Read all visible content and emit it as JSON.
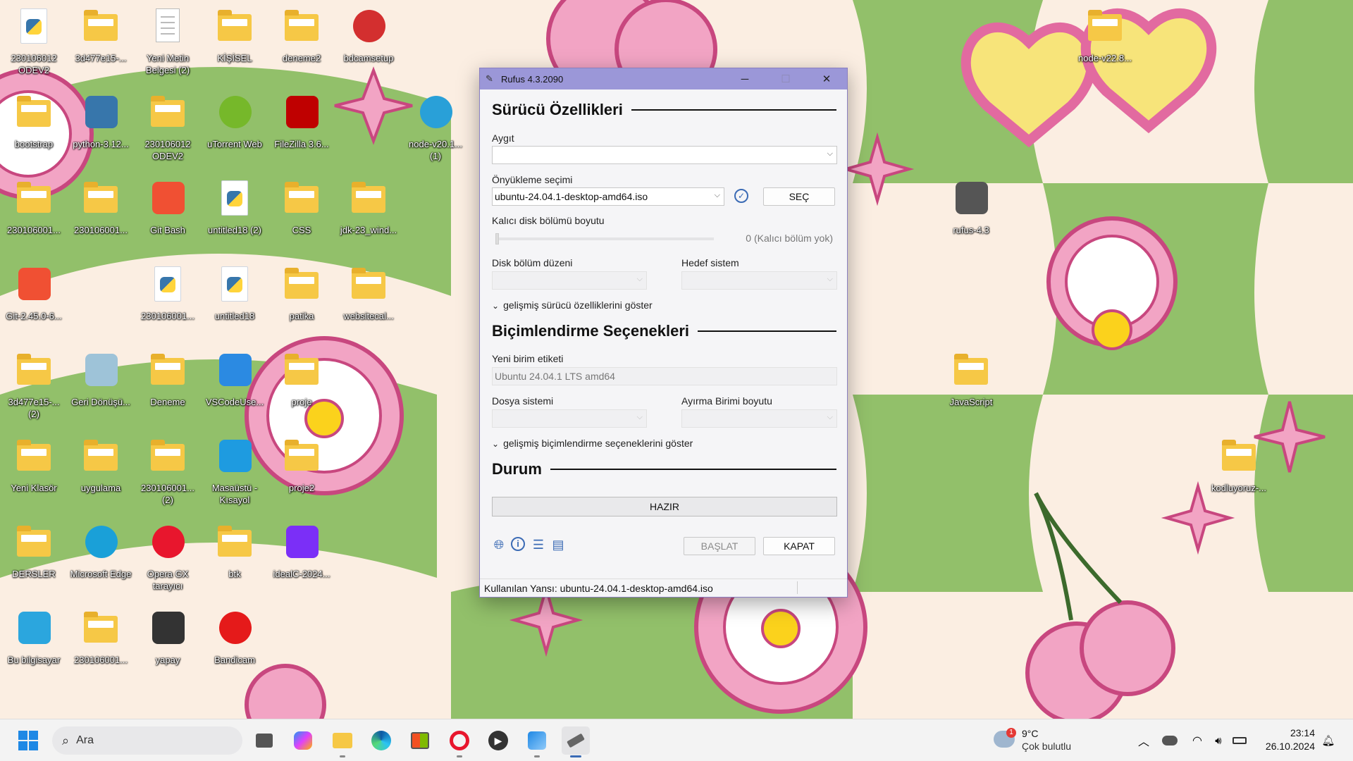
{
  "desktop": {
    "icons": [
      {
        "label": "230106012 ODEV2",
        "icon": "python-file-icon"
      },
      {
        "label": "3d477e15-...",
        "icon": "folder-icon"
      },
      {
        "label": "Yeni Metin Belgesi (2)",
        "icon": "text-document-icon"
      },
      {
        "label": "KİŞİSEL",
        "icon": "folder-icon"
      },
      {
        "label": "deneme2",
        "icon": "folder-icon"
      },
      {
        "label": "bdcamsetup",
        "icon": "installer-icon"
      },
      {
        "label": "bootstrap",
        "icon": "folder-icon"
      },
      {
        "label": "python-3.12...",
        "icon": "python-installer-icon"
      },
      {
        "label": "230106012 ODEV2",
        "icon": "folder-icon"
      },
      {
        "label": "uTorrent Web",
        "icon": "utorrent-icon"
      },
      {
        "label": "FileZilla 3.6...",
        "icon": "filezilla-icon"
      },
      {
        "label": "node-v20.1... (1)",
        "icon": "disc-image-icon"
      },
      {
        "label": "230106001...",
        "icon": "folder-icon"
      },
      {
        "label": "230106001...",
        "icon": "folder-icon"
      },
      {
        "label": "Git Bash",
        "icon": "git-icon"
      },
      {
        "label": "untitled18 (2)",
        "icon": "python-file-icon"
      },
      {
        "label": "CSS",
        "icon": "folder-icon"
      },
      {
        "label": "jdk-23_wind...",
        "icon": "folder-icon"
      },
      {
        "label": "Git-2.45.0-6...",
        "icon": "git-icon"
      },
      {
        "label": "230106001...",
        "icon": "python-file-icon"
      },
      {
        "label": "untitled18",
        "icon": "python-file-icon"
      },
      {
        "label": "patika",
        "icon": "folder-icon"
      },
      {
        "label": "websitecal...",
        "icon": "folder-icon"
      },
      {
        "label": "3d477e15-... (2)",
        "icon": "folder-icon"
      },
      {
        "label": "Geri Dönüşü...",
        "icon": "recycle-bin-icon"
      },
      {
        "label": "Deneme",
        "icon": "folder-icon"
      },
      {
        "label": "VSCodeUse...",
        "icon": "vscode-icon"
      },
      {
        "label": "proje",
        "icon": "folder-icon"
      },
      {
        "label": "Yeni Klasör",
        "icon": "folder-icon"
      },
      {
        "label": "uygulama",
        "icon": "folder-icon"
      },
      {
        "label": "230106001... (2)",
        "icon": "folder-icon"
      },
      {
        "label": "Masaüstü - Kısayol",
        "icon": "desktop-shortcut-icon"
      },
      {
        "label": "proje2",
        "icon": "folder-icon"
      },
      {
        "label": "DERSLER",
        "icon": "folder-icon"
      },
      {
        "label": "Microsoft Edge",
        "icon": "edge-icon"
      },
      {
        "label": "Opera GX tarayıcı",
        "icon": "opera-icon"
      },
      {
        "label": "btk",
        "icon": "folder-icon"
      },
      {
        "label": "idealC-2024...",
        "icon": "intellij-icon"
      },
      {
        "label": "Bu bilgisayar",
        "icon": "computer-icon"
      },
      {
        "label": "230106001...",
        "icon": "folder-icon"
      },
      {
        "label": "yapay",
        "icon": "image-icon"
      },
      {
        "label": "Bandicam",
        "icon": "bandicam-icon"
      },
      {
        "label": "node-v22.8...",
        "icon": "folder-icon"
      },
      {
        "label": "rufus-4.3",
        "icon": "rufus-icon"
      },
      {
        "label": "JavaScript",
        "icon": "folder-icon"
      },
      {
        "label": "kodluyoruz-...",
        "icon": "folder-icon"
      }
    ]
  },
  "rufus": {
    "title": "Rufus 4.3.2090",
    "drive_section": "Sürücü Özellikleri",
    "device_label": "Aygıt",
    "device_value": "",
    "boot_label": "Önyükleme seçimi",
    "boot_value": "ubuntu-24.04.1-desktop-amd64.iso",
    "select_button": "SEÇ",
    "persistent_label": "Kalıcı disk bölümü boyutu",
    "persistent_value": "0 (Kalıcı bölüm yok)",
    "persistent_level": 0,
    "partition_label": "Disk bölüm düzeni",
    "target_label": "Hedef sistem",
    "adv_drive": "gelişmiş sürücü özelliklerini göster",
    "format_section": "Biçimlendirme Seçenekleri",
    "volume_label": "Yeni birim etiketi",
    "volume_value": "Ubuntu 24.04.1 LTS amd64",
    "fs_label": "Dosya sistemi",
    "cluster_label": "Ayırma Birimi boyutu",
    "adv_format": "gelişmiş biçimlendirme seçeneklerini göster",
    "status_section": "Durum",
    "status_text": "HAZIR",
    "start_button": "BAŞLAT",
    "close_button": "KAPAT",
    "statusbar_text": "Kullanılan Yansı: ubuntu-24.04.1-desktop-amd64.iso"
  },
  "taskbar": {
    "search_placeholder": "Ara",
    "weather_temp": "9°C",
    "weather_desc": "Çok bulutlu",
    "weather_badge": "1",
    "time": "23:14",
    "date": "26.10.2024"
  }
}
